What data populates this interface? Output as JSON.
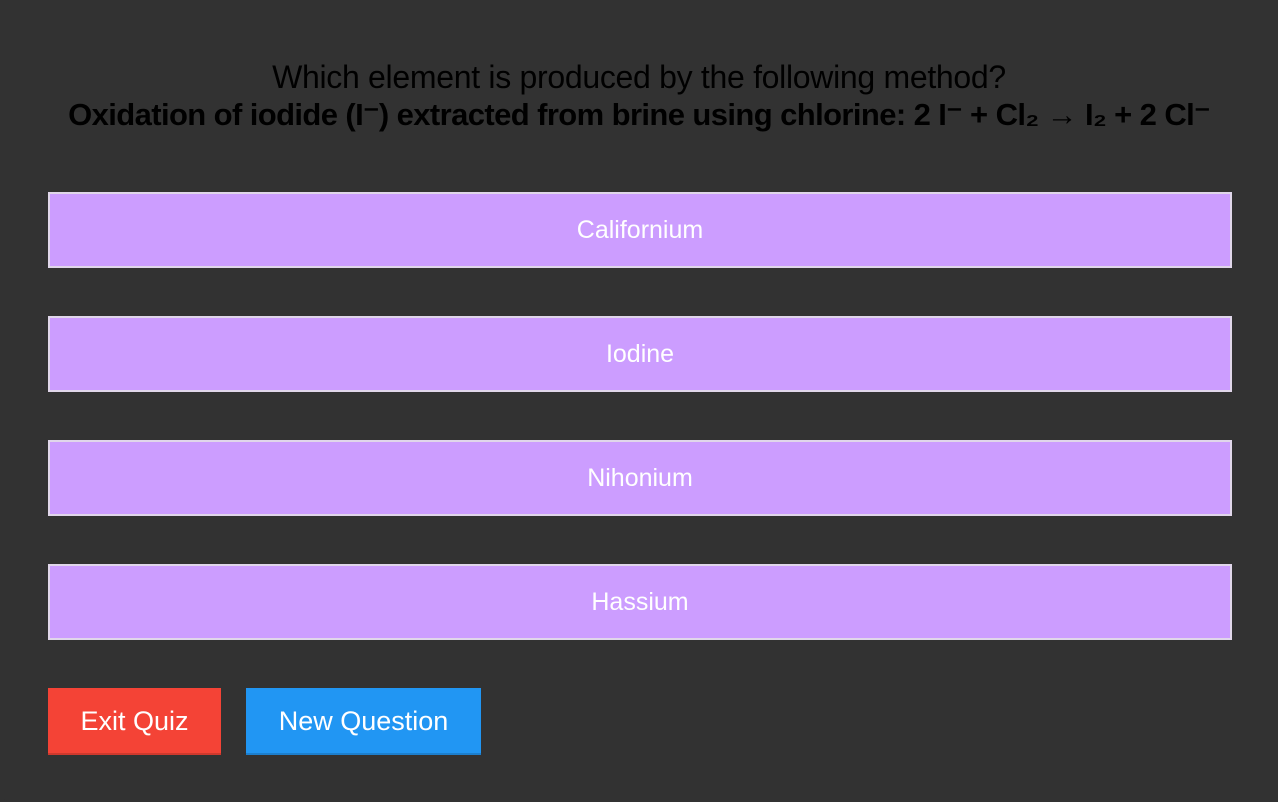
{
  "question": {
    "prompt": "Which element is produced by the following method?",
    "detail": "Oxidation of iodide (I⁻) extracted from brine using chlorine: 2 I⁻ + Cl₂ → I₂ + 2 Cl⁻"
  },
  "answers": [
    {
      "label": "Californium"
    },
    {
      "label": "Iodine"
    },
    {
      "label": "Nihonium"
    },
    {
      "label": "Hassium"
    }
  ],
  "controls": {
    "exit_label": "Exit Quiz",
    "new_question_label": "New Question"
  },
  "colors": {
    "background": "#323232",
    "answer_fill": "#cc9dff",
    "exit_button": "#f44336",
    "new_question_button": "#2196f3"
  }
}
